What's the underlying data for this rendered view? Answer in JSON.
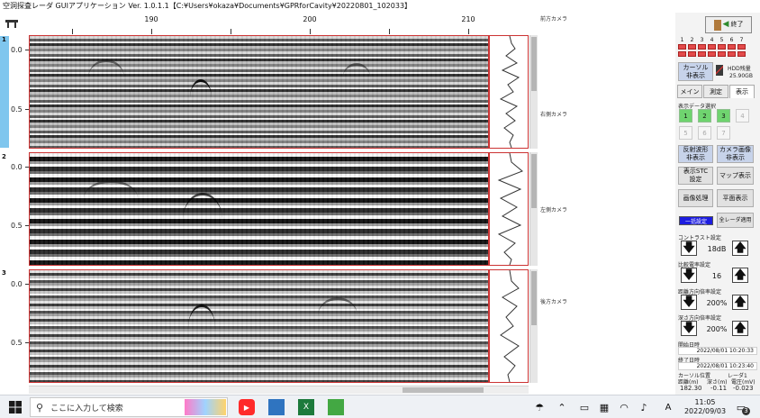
{
  "window": {
    "title": "空洞探査レーダ GUIアプリケーション Ver. 1.0.1.1【C:¥Users¥okaza¥Documents¥GPRforCavity¥20220801_102033】"
  },
  "top_axis": {
    "ticks": [
      "190",
      "200",
      "210"
    ]
  },
  "panels": [
    {
      "number": "1",
      "camera": "右側カメラ",
      "yticks": [
        "0.0",
        "0.5"
      ]
    },
    {
      "number": "2",
      "camera": "左側カメラ",
      "yticks": [
        "0.0",
        "0.5"
      ]
    },
    {
      "number": "3",
      "camera": "後方カメラ",
      "yticks": [
        "0.0",
        "0.5"
      ]
    }
  ],
  "front_camera_label": "前方カメラ",
  "sidebar": {
    "exit_label": "終了",
    "channels": [
      "1",
      "2",
      "3",
      "4",
      "5",
      "6",
      "7"
    ],
    "cursor_toggle": "カーソル\n非表示",
    "hdd_label": "HDD残量",
    "hdd_value": "25.90GB",
    "tabs": [
      "メイン",
      "測定",
      "表示"
    ],
    "active_tab": "表示",
    "data_select_label": "表示データ選択",
    "data_buttons": [
      {
        "label": "1",
        "on": true
      },
      {
        "label": "2",
        "on": true
      },
      {
        "label": "3",
        "on": true
      },
      {
        "label": "4",
        "on": false
      },
      {
        "label": "5",
        "on": false
      },
      {
        "label": "6",
        "on": false
      },
      {
        "label": "7",
        "on": false
      }
    ],
    "btn_reflect": "反射波形\n非表示",
    "btn_camera": "カメラ画像\n非表示",
    "btn_stc": "表示STC\n設定",
    "btn_map": "マップ表示",
    "btn_imgproc": "画像処理",
    "btn_plane": "平面表示",
    "btn_batch": "一括設定",
    "btn_all_radar": "全レーダ適用",
    "contrast_label": "コントラスト設定",
    "contrast_value": "18dB",
    "comparison_label": "比較電率設定",
    "comparison_value": "16",
    "h_stretch_label": "距離方向倍率設定",
    "h_stretch_value": "200%",
    "v_stretch_label": "深さ方向倍率設定",
    "v_stretch_value": "200%",
    "start_time_label": "開始日時",
    "start_time": "2022/08/01 10:20:33",
    "end_time_label": "終了日時",
    "end_time": "2022/08/01 10:23:40",
    "cursor_pos_label": "カーソル位置",
    "radar_label": "レーダ1",
    "col_distance": "距離(m)",
    "col_depth": "深さ(m)",
    "col_voltage": "電圧(mV)",
    "val_distance": "182.30",
    "val_depth": "-0.11",
    "val_voltage": "-0.023"
  },
  "taskbar": {
    "search_placeholder": "ここに入力して検索",
    "time": "11:05",
    "date": "2022/09/03",
    "ime": "A",
    "notify_count": "3"
  }
}
